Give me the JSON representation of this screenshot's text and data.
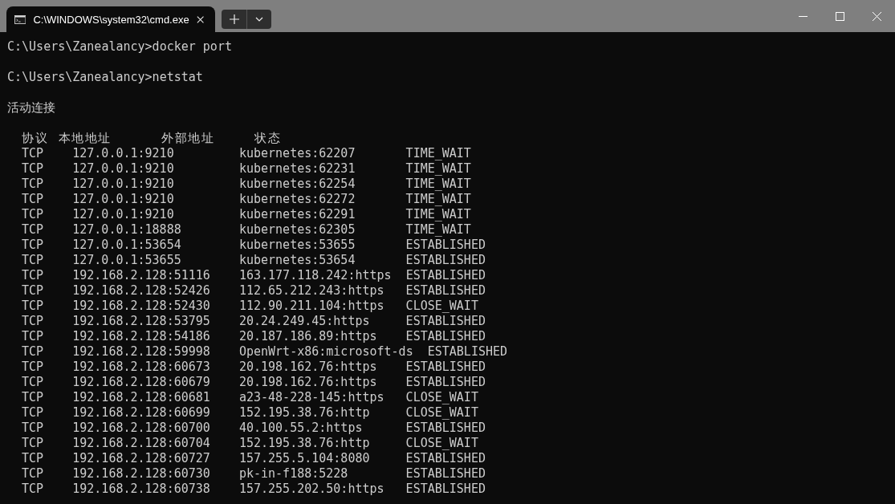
{
  "tabs": [
    {
      "title": "C:\\WINDOWS\\system32\\cmd.exe",
      "selected": true
    }
  ],
  "console": {
    "lines": [
      {
        "kind": "command",
        "text": "C:\\Users\\Zanealancy>docker port"
      },
      {
        "kind": "blank"
      },
      {
        "kind": "command",
        "text": "C:\\Users\\Zanealancy>netstat"
      },
      {
        "kind": "blank"
      },
      {
        "kind": "heading",
        "text": "活动连接"
      },
      {
        "kind": "blank"
      }
    ],
    "table": {
      "header_line": "协议  本地地址          外部地址        状态",
      "rows": [
        [
          "TCP",
          "127.0.0.1:9210",
          "kubernetes:62207",
          "TIME_WAIT"
        ],
        [
          "TCP",
          "127.0.0.1:9210",
          "kubernetes:62231",
          "TIME_WAIT"
        ],
        [
          "TCP",
          "127.0.0.1:9210",
          "kubernetes:62254",
          "TIME_WAIT"
        ],
        [
          "TCP",
          "127.0.0.1:9210",
          "kubernetes:62272",
          "TIME_WAIT"
        ],
        [
          "TCP",
          "127.0.0.1:9210",
          "kubernetes:62291",
          "TIME_WAIT"
        ],
        [
          "TCP",
          "127.0.0.1:18888",
          "kubernetes:62305",
          "TIME_WAIT"
        ],
        [
          "TCP",
          "127.0.0.1:53654",
          "kubernetes:53655",
          "ESTABLISHED"
        ],
        [
          "TCP",
          "127.0.0.1:53655",
          "kubernetes:53654",
          "ESTABLISHED"
        ],
        [
          "TCP",
          "192.168.2.128:51116",
          "163.177.118.242:https",
          "ESTABLISHED"
        ],
        [
          "TCP",
          "192.168.2.128:52426",
          "112.65.212.243:https",
          "ESTABLISHED"
        ],
        [
          "TCP",
          "192.168.2.128:52430",
          "112.90.211.104:https",
          "CLOSE_WAIT"
        ],
        [
          "TCP",
          "192.168.2.128:53795",
          "20.24.249.45:https",
          "ESTABLISHED"
        ],
        [
          "TCP",
          "192.168.2.128:54186",
          "20.187.186.89:https",
          "ESTABLISHED"
        ],
        [
          "TCP",
          "192.168.2.128:59998",
          "OpenWrt-x86:microsoft-ds",
          "ESTABLISHED"
        ],
        [
          "TCP",
          "192.168.2.128:60673",
          "20.198.162.76:https",
          "ESTABLISHED"
        ],
        [
          "TCP",
          "192.168.2.128:60679",
          "20.198.162.76:https",
          "ESTABLISHED"
        ],
        [
          "TCP",
          "192.168.2.128:60681",
          "a23-48-228-145:https",
          "CLOSE_WAIT"
        ],
        [
          "TCP",
          "192.168.2.128:60699",
          "152.195.38.76:http",
          "CLOSE_WAIT"
        ],
        [
          "TCP",
          "192.168.2.128:60700",
          "40.100.55.2:https",
          "ESTABLISHED"
        ],
        [
          "TCP",
          "192.168.2.128:60704",
          "152.195.38.76:http",
          "CLOSE_WAIT"
        ],
        [
          "TCP",
          "192.168.2.128:60727",
          "157.255.5.104:8080",
          "ESTABLISHED"
        ],
        [
          "TCP",
          "192.168.2.128:60730",
          "pk-in-f188:5228",
          "ESTABLISHED"
        ],
        [
          "TCP",
          "192.168.2.128:60738",
          "157.255.202.50:https",
          "ESTABLISHED"
        ]
      ]
    }
  }
}
